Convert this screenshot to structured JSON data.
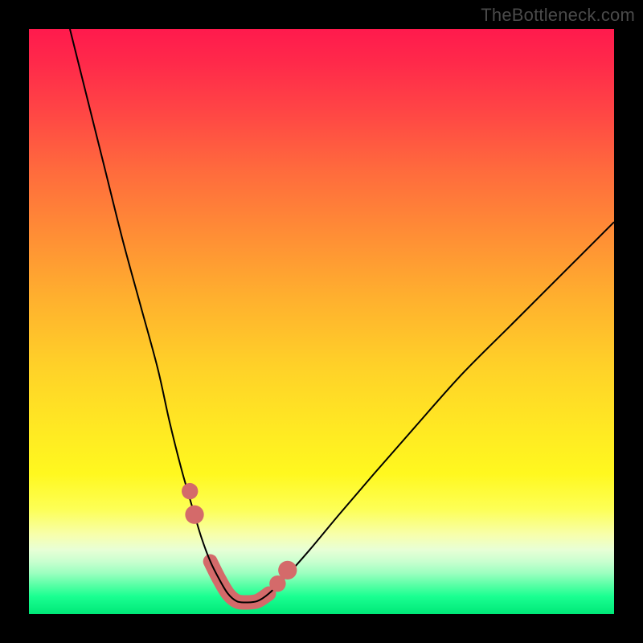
{
  "attribution": "TheBottleneck.com",
  "colors": {
    "frame": "#000000",
    "curve": "#000000",
    "marker": "#d46a6a",
    "attribution_text": "#4a4a4a"
  },
  "chart_data": {
    "type": "line",
    "title": "",
    "xlabel": "",
    "ylabel": "",
    "xlim": [
      0,
      100
    ],
    "ylim": [
      0,
      100
    ],
    "grid": false,
    "legend": false,
    "series": [
      {
        "name": "bottleneck-curve",
        "x": [
          7,
          10,
          13,
          16,
          19,
          22,
          24,
          26,
          28,
          29.5,
          31,
          32.5,
          34,
          35.5,
          37,
          39,
          41,
          44,
          48,
          53,
          59,
          66,
          74,
          83,
          93,
          100
        ],
        "y": [
          100,
          88,
          76,
          64,
          53,
          42,
          33,
          25,
          18,
          13,
          9,
          6,
          3.5,
          2.2,
          2,
          2.2,
          3.5,
          6.5,
          11,
          17,
          24,
          32,
          41,
          50,
          60,
          67
        ]
      }
    ],
    "highlight_segment": {
      "x": [
        31,
        32.5,
        34,
        35.5,
        37,
        39,
        41
      ],
      "y": [
        9,
        6,
        3.5,
        2.2,
        2,
        2.2,
        3.5
      ]
    },
    "markers": [
      {
        "x": 27.5,
        "y": 21,
        "r": 1.4
      },
      {
        "x": 28.3,
        "y": 17,
        "r": 1.6
      },
      {
        "x": 42.5,
        "y": 5.2,
        "r": 1.4
      },
      {
        "x": 44.2,
        "y": 7.5,
        "r": 1.6
      }
    ]
  }
}
